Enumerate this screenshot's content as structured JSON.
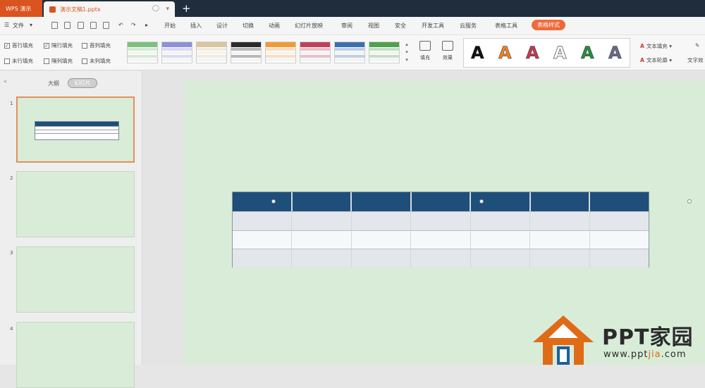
{
  "app": {
    "app_tab_label": "WPS 演示",
    "doc_tab_label": "演示文稿1.pptx",
    "new_tab_icon": "plus-icon"
  },
  "menu": {
    "file_label": "文件",
    "items": [
      "开始",
      "插入",
      "设计",
      "切换",
      "动画",
      "幻灯片放映",
      "审阅",
      "视图",
      "安全",
      "开发工具",
      "云服务",
      "表格工具",
      "表格样式"
    ],
    "active_item": "表格样式"
  },
  "ribbon": {
    "checkboxes": [
      {
        "label": "首行填充",
        "checked": true
      },
      {
        "label": "隔行填充",
        "checked": true
      },
      {
        "label": "首列填充",
        "checked": false
      },
      {
        "label": "末行填充",
        "checked": false
      },
      {
        "label": "隔列填充",
        "checked": false
      },
      {
        "label": "末列填充",
        "checked": false
      }
    ],
    "table_style_colors": [
      "#7fbf7f",
      "#8f8fd8",
      "#d8c79f",
      "#2b2b2b",
      "#ef9b3a",
      "#c0405a",
      "#3b6fb0",
      "#4fa04f"
    ],
    "fill_label": "填充",
    "effect_label": "效果",
    "wordart_colors": [
      "#111111",
      "#e8832a",
      "#c03a4f",
      "#ffffff",
      "#2e8b3e",
      "#6a6a8a"
    ],
    "wordart_glyph": "A",
    "text_fill_label": "文本填充",
    "text_outline_label": "文本轮廓",
    "text_effect_label": "文字效"
  },
  "panel": {
    "outline_label": "大纲",
    "slides_label": "幻灯片",
    "slide_numbers": [
      "1",
      "2",
      "3",
      "4"
    ]
  },
  "watermark": {
    "title": "PPT家园",
    "url_pre": "www.ppt",
    "url_highlight": "jia",
    "url_post": ".com"
  }
}
